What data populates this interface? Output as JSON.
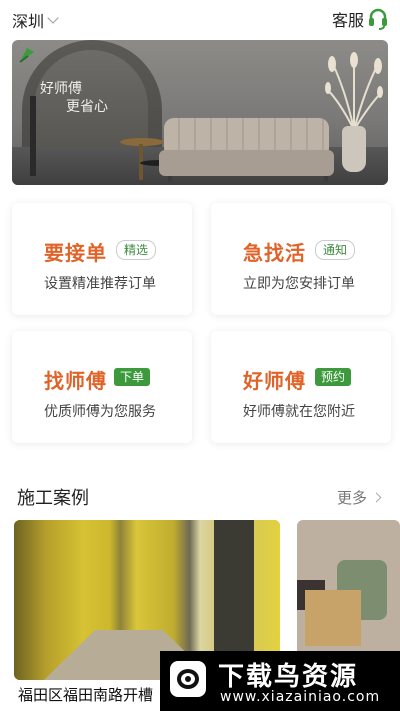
{
  "header": {
    "city": "深圳",
    "service_label": "客服"
  },
  "banner": {
    "slogan_line1": "好师傅",
    "slogan_line2": "更省心"
  },
  "cards": [
    {
      "title": "要接单",
      "tag": "精选",
      "tag_style": "outline",
      "desc": "设置精准推荐订单"
    },
    {
      "title": "急找活",
      "tag": "通知",
      "tag_style": "outline",
      "desc": "立即为您安排订单"
    },
    {
      "title": "找师傅",
      "tag": "下单",
      "tag_style": "filled",
      "desc": "优质师傅为您服务"
    },
    {
      "title": "好师傅",
      "tag": "预约",
      "tag_style": "filled",
      "desc": "好师傅就在您附近"
    }
  ],
  "cases_section": {
    "title": "施工案例",
    "more_label": "更多"
  },
  "cases": [
    {
      "caption": "福田区福田南路开槽"
    }
  ],
  "watermark": {
    "text": "下载鸟资源",
    "url": "www.xiazainiao.com"
  },
  "colors": {
    "accent_orange": "#e0642a",
    "accent_green": "#3c9a3c"
  },
  "icons": {
    "service": "headset-icon",
    "city_dropdown": "chevron-down-icon",
    "more": "chevron-right-icon"
  }
}
